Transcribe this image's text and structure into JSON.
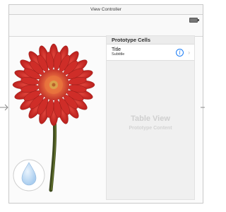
{
  "controller": {
    "title": "View Controller"
  },
  "table": {
    "section_header": "Prototype Cells",
    "cell": {
      "title": "Title",
      "subtitle": "Subtitle",
      "info_icon": "info-icon",
      "accessory_icon": "chevron-right-icon"
    },
    "placeholder_title": "Table View",
    "placeholder_subtitle": "Prototype Content"
  },
  "icons": {
    "battery": "battery-icon",
    "entry_arrow": "arrow-right-icon",
    "water_drop": "water-drop-icon",
    "flower": "flower-image"
  },
  "colors": {
    "accent": "#1a7cf5",
    "petal": "#d6322d",
    "drop": "#bdd9f2"
  }
}
